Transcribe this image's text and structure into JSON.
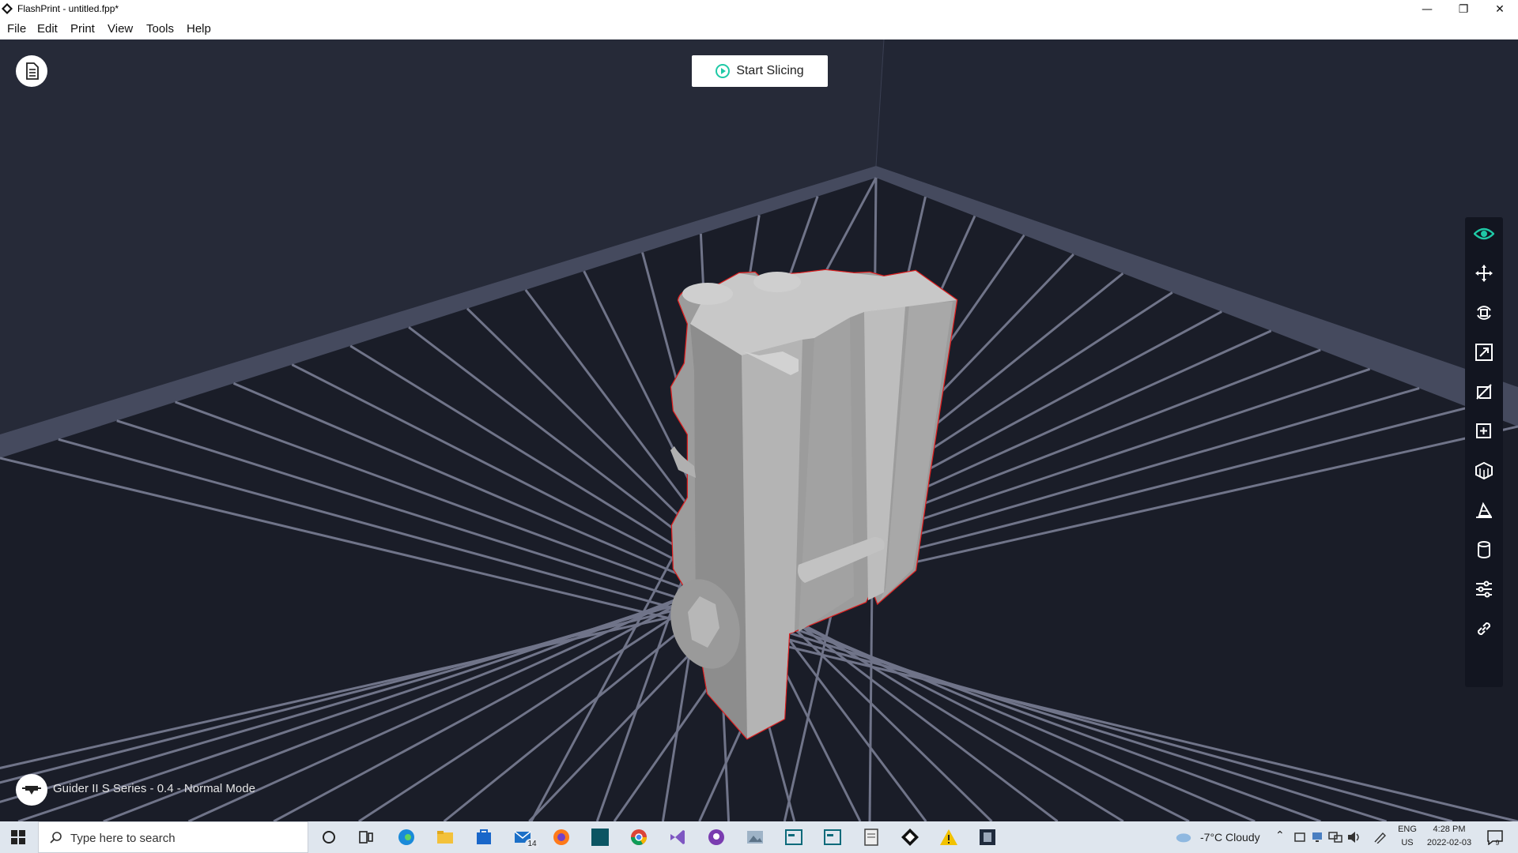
{
  "window": {
    "title": "FlashPrint - untitled.fpp*",
    "controls": [
      "minimize-icon",
      "restore-icon",
      "close-icon"
    ]
  },
  "menu": [
    "File",
    "Edit",
    "Print",
    "View",
    "Tools",
    "Help"
  ],
  "toolbar_top": {
    "start_slicing_label": "Start Slicing",
    "accent_color": "#1fc9a6"
  },
  "right_toolbar": {
    "tools": [
      "view-eye-icon",
      "move-icon",
      "rotate-icon",
      "scale-icon",
      "cut-icon",
      "add-model-icon",
      "supports-icon",
      "lay-flat-icon",
      "cylinder-icon",
      "settings-sliders-icon",
      "link-icon"
    ],
    "active_tool": "view-eye-icon"
  },
  "status": {
    "printer_mode": "Guider II S Series - 0.4 - Normal Mode"
  },
  "colors": {
    "viewport_bg": "#1b1e29",
    "model_gray": "#a9a9a9",
    "model_outline": "#e02020",
    "grid_line": "#8b90a6"
  },
  "taskbar": {
    "search_placeholder": "Type here to search",
    "apps": [
      "cortana-icon",
      "task-view-icon",
      "edge-icon",
      "file-explorer-icon",
      "store-icon",
      "mail-icon",
      "firefox-icon",
      "terminal-icon",
      "chrome-icon",
      "visual-studio-icon",
      "github-icon",
      "photos-icon",
      "window-icon",
      "window-icon-2",
      "notepad-icon",
      "flashprint-icon",
      "warning-icon",
      "app-icon"
    ],
    "mail_badge": "14",
    "weather": "-7°C  Cloudy",
    "lang_top": "ENG",
    "lang_bottom": "US",
    "time": "4:28 PM",
    "date": "2022-02-03",
    "notifications": "9"
  }
}
